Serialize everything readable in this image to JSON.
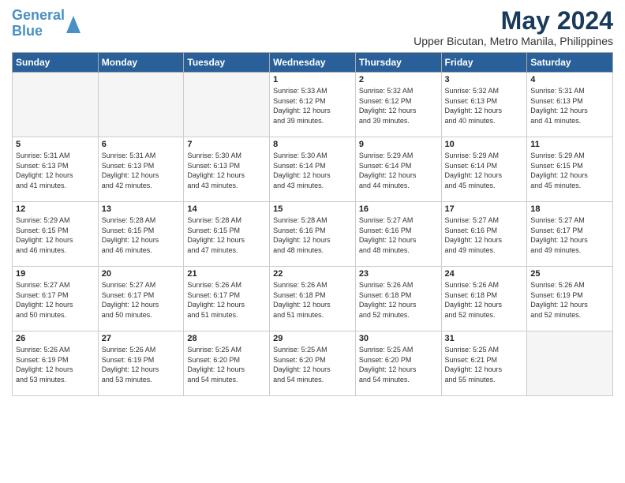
{
  "header": {
    "logo_line1": "General",
    "logo_line2": "Blue",
    "title": "May 2024",
    "location": "Upper Bicutan, Metro Manila, Philippines"
  },
  "weekdays": [
    "Sunday",
    "Monday",
    "Tuesday",
    "Wednesday",
    "Thursday",
    "Friday",
    "Saturday"
  ],
  "weeks": [
    [
      {
        "day": "",
        "info": ""
      },
      {
        "day": "",
        "info": ""
      },
      {
        "day": "",
        "info": ""
      },
      {
        "day": "1",
        "info": "Sunrise: 5:33 AM\nSunset: 6:12 PM\nDaylight: 12 hours\nand 39 minutes."
      },
      {
        "day": "2",
        "info": "Sunrise: 5:32 AM\nSunset: 6:12 PM\nDaylight: 12 hours\nand 39 minutes."
      },
      {
        "day": "3",
        "info": "Sunrise: 5:32 AM\nSunset: 6:13 PM\nDaylight: 12 hours\nand 40 minutes."
      },
      {
        "day": "4",
        "info": "Sunrise: 5:31 AM\nSunset: 6:13 PM\nDaylight: 12 hours\nand 41 minutes."
      }
    ],
    [
      {
        "day": "5",
        "info": "Sunrise: 5:31 AM\nSunset: 6:13 PM\nDaylight: 12 hours\nand 41 minutes."
      },
      {
        "day": "6",
        "info": "Sunrise: 5:31 AM\nSunset: 6:13 PM\nDaylight: 12 hours\nand 42 minutes."
      },
      {
        "day": "7",
        "info": "Sunrise: 5:30 AM\nSunset: 6:13 PM\nDaylight: 12 hours\nand 43 minutes."
      },
      {
        "day": "8",
        "info": "Sunrise: 5:30 AM\nSunset: 6:14 PM\nDaylight: 12 hours\nand 43 minutes."
      },
      {
        "day": "9",
        "info": "Sunrise: 5:29 AM\nSunset: 6:14 PM\nDaylight: 12 hours\nand 44 minutes."
      },
      {
        "day": "10",
        "info": "Sunrise: 5:29 AM\nSunset: 6:14 PM\nDaylight: 12 hours\nand 45 minutes."
      },
      {
        "day": "11",
        "info": "Sunrise: 5:29 AM\nSunset: 6:15 PM\nDaylight: 12 hours\nand 45 minutes."
      }
    ],
    [
      {
        "day": "12",
        "info": "Sunrise: 5:29 AM\nSunset: 6:15 PM\nDaylight: 12 hours\nand 46 minutes."
      },
      {
        "day": "13",
        "info": "Sunrise: 5:28 AM\nSunset: 6:15 PM\nDaylight: 12 hours\nand 46 minutes."
      },
      {
        "day": "14",
        "info": "Sunrise: 5:28 AM\nSunset: 6:15 PM\nDaylight: 12 hours\nand 47 minutes."
      },
      {
        "day": "15",
        "info": "Sunrise: 5:28 AM\nSunset: 6:16 PM\nDaylight: 12 hours\nand 48 minutes."
      },
      {
        "day": "16",
        "info": "Sunrise: 5:27 AM\nSunset: 6:16 PM\nDaylight: 12 hours\nand 48 minutes."
      },
      {
        "day": "17",
        "info": "Sunrise: 5:27 AM\nSunset: 6:16 PM\nDaylight: 12 hours\nand 49 minutes."
      },
      {
        "day": "18",
        "info": "Sunrise: 5:27 AM\nSunset: 6:17 PM\nDaylight: 12 hours\nand 49 minutes."
      }
    ],
    [
      {
        "day": "19",
        "info": "Sunrise: 5:27 AM\nSunset: 6:17 PM\nDaylight: 12 hours\nand 50 minutes."
      },
      {
        "day": "20",
        "info": "Sunrise: 5:27 AM\nSunset: 6:17 PM\nDaylight: 12 hours\nand 50 minutes."
      },
      {
        "day": "21",
        "info": "Sunrise: 5:26 AM\nSunset: 6:17 PM\nDaylight: 12 hours\nand 51 minutes."
      },
      {
        "day": "22",
        "info": "Sunrise: 5:26 AM\nSunset: 6:18 PM\nDaylight: 12 hours\nand 51 minutes."
      },
      {
        "day": "23",
        "info": "Sunrise: 5:26 AM\nSunset: 6:18 PM\nDaylight: 12 hours\nand 52 minutes."
      },
      {
        "day": "24",
        "info": "Sunrise: 5:26 AM\nSunset: 6:18 PM\nDaylight: 12 hours\nand 52 minutes."
      },
      {
        "day": "25",
        "info": "Sunrise: 5:26 AM\nSunset: 6:19 PM\nDaylight: 12 hours\nand 52 minutes."
      }
    ],
    [
      {
        "day": "26",
        "info": "Sunrise: 5:26 AM\nSunset: 6:19 PM\nDaylight: 12 hours\nand 53 minutes."
      },
      {
        "day": "27",
        "info": "Sunrise: 5:26 AM\nSunset: 6:19 PM\nDaylight: 12 hours\nand 53 minutes."
      },
      {
        "day": "28",
        "info": "Sunrise: 5:25 AM\nSunset: 6:20 PM\nDaylight: 12 hours\nand 54 minutes."
      },
      {
        "day": "29",
        "info": "Sunrise: 5:25 AM\nSunset: 6:20 PM\nDaylight: 12 hours\nand 54 minutes."
      },
      {
        "day": "30",
        "info": "Sunrise: 5:25 AM\nSunset: 6:20 PM\nDaylight: 12 hours\nand 54 minutes."
      },
      {
        "day": "31",
        "info": "Sunrise: 5:25 AM\nSunset: 6:21 PM\nDaylight: 12 hours\nand 55 minutes."
      },
      {
        "day": "",
        "info": ""
      }
    ]
  ]
}
